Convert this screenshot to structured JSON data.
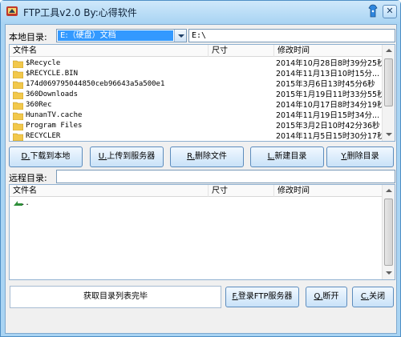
{
  "window": {
    "title": "FTP工具v2.0 By:心得软件"
  },
  "local": {
    "label": "本地目录:",
    "drive_selected": "E:（硬盘）文档",
    "path_value": "E:\\",
    "columns": {
      "name": "文件名",
      "size": "尺寸",
      "modified": "修改时间"
    },
    "files": [
      {
        "name": "$Recycle",
        "size": "",
        "modified": "2014年10月28日8时39分25秒"
      },
      {
        "name": "$RECYCLE.BIN",
        "size": "",
        "modified": "2014年11月13日10时15分..."
      },
      {
        "name": "174d069795044850ceb96643a5a500e1",
        "size": "",
        "modified": "2015年3月6日13时45分6秒"
      },
      {
        "name": "360Downloads",
        "size": "",
        "modified": "2015年1月19日11时33分55秒"
      },
      {
        "name": "360Rec",
        "size": "",
        "modified": "2014年10月17日8时34分19秒"
      },
      {
        "name": "HunanTV.cache",
        "size": "",
        "modified": "2014年11月19日15时34分..."
      },
      {
        "name": "Program Files",
        "size": "",
        "modified": "2015年3月2日10时42分36秒"
      },
      {
        "name": "RECYCLER",
        "size": "",
        "modified": "2014年11月5日15时30分17秒"
      }
    ]
  },
  "actions": {
    "download": {
      "key": "D.",
      "label": "下载到本地"
    },
    "upload": {
      "key": "U.",
      "label": "上传到服务器"
    },
    "delete_file": {
      "key": "R.",
      "label": "删除文件"
    },
    "new_dir": {
      "key": "L.",
      "label": "新建目录"
    },
    "delete_dir": {
      "key": "Y.",
      "label": "删除目录"
    }
  },
  "remote": {
    "label": "远程目录:",
    "path_value": "",
    "columns": {
      "name": "文件名",
      "size": "尺寸",
      "modified": "修改时间"
    },
    "parent_entry": ".."
  },
  "status": {
    "text": "获取目录列表完毕"
  },
  "bottom_buttons": {
    "login": {
      "key": "F.",
      "label": "登录FTP服务器"
    },
    "disconnect": {
      "key": "Q.",
      "label": "断开"
    },
    "close": {
      "key": "C.",
      "label": "关闭"
    }
  },
  "colors": {
    "accent": "#3399ff",
    "frame": "#a9d4f3",
    "folder": "#f2c84b"
  },
  "icons": {
    "app": "app-icon",
    "skin": "skin-icon",
    "folder": "folder-icon",
    "up": "up-directory-icon"
  }
}
